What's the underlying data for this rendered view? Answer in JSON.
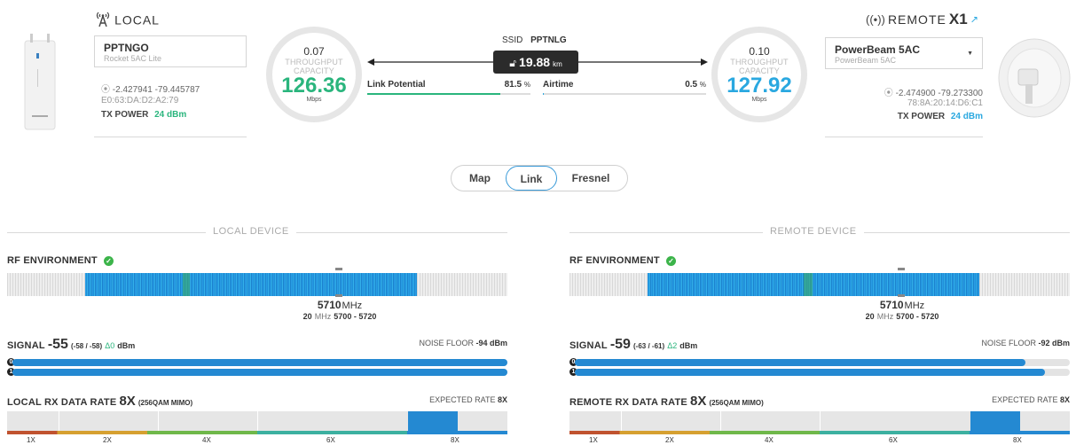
{
  "local": {
    "header": "LOCAL",
    "device_name": "PPTNGO",
    "device_model": "Rocket 5AC Lite",
    "coords": "-2.427941 -79.445787",
    "mac": "E0:63:DA:D2:A2:79",
    "tx_power_label": "TX POWER",
    "tx_power_value": "24 dBm",
    "throughput": "0.07",
    "throughput_label": "THROUGHPUT",
    "capacity_label": "CAPACITY",
    "capacity": "126.36",
    "unit": "Mbps"
  },
  "remote": {
    "header": "REMOTE",
    "count": "X1",
    "device_name": "PowerBeam 5AC",
    "device_model": "PowerBeam 5AC",
    "coords": "-2.474900 -79.273300",
    "mac": "78:8A:20:14:D6:C1",
    "tx_power_label": "TX POWER",
    "tx_power_value": "24 dBm",
    "throughput": "0.10",
    "throughput_label": "THROUGHPUT",
    "capacity_label": "CAPACITY",
    "capacity": "127.92",
    "unit": "Mbps"
  },
  "link": {
    "ssid_label": "SSID",
    "ssid": "PPTNLG",
    "distance": "19.88",
    "distance_unit": "km",
    "potential_label": "Link Potential",
    "potential_value": "81.5",
    "potential_pct": 81.5,
    "airtime_label": "Airtime",
    "airtime_value": "0.5",
    "airtime_pct": 0.5,
    "pct": "%"
  },
  "tabs": [
    "Map",
    "Link",
    "Fresnel"
  ],
  "active_tab": "Link",
  "local_section": {
    "title": "LOCAL DEVICE",
    "rf_label": "RF ENVIRONMENT",
    "freq": "5710",
    "freq_unit": "MHz",
    "width": "20",
    "width_unit": "MHz",
    "range": "5700 - 5720",
    "signal_label": "SIGNAL",
    "signal": "-55",
    "signal_chains": "(-58 / -58)",
    "signal_delta": "Δ0",
    "signal_unit": "dBm",
    "noise_label": "NOISE FLOOR",
    "noise": "-94 dBm",
    "chain0": "0",
    "chain1": "1",
    "chain0_level": 1.0,
    "chain1_level": 1.0,
    "rate_label": "LOCAL RX DATA RATE",
    "rate": "8X",
    "rate_detail": "(256QAM MIMO)",
    "expected_label": "EXPECTED RATE",
    "expected": "8X",
    "rate_ticks": [
      "1X",
      "2X",
      "4X",
      "6X",
      "8X"
    ]
  },
  "remote_section": {
    "title": "REMOTE DEVICE",
    "rf_label": "RF ENVIRONMENT",
    "freq": "5710",
    "freq_unit": "MHz",
    "width": "20",
    "width_unit": "MHz",
    "range": "5700 - 5720",
    "signal_label": "SIGNAL",
    "signal": "-59",
    "signal_chains": "(-63 / -61)",
    "signal_delta": "Δ2",
    "signal_unit": "dBm",
    "noise_label": "NOISE FLOOR",
    "noise": "-92 dBm",
    "chain0": "0",
    "chain1": "1",
    "chain0_level": 0.91,
    "chain1_level": 0.95,
    "rate_label": "REMOTE RX DATA RATE",
    "rate": "8X",
    "rate_detail": "(256QAM MIMO)",
    "expected_label": "EXPECTED RATE",
    "expected": "8X",
    "rate_ticks": [
      "1X",
      "2X",
      "4X",
      "6X",
      "8X"
    ]
  },
  "colors": {
    "green": "#2ab57d",
    "blue": "#2aa8e0",
    "bar_blue": "#2489d2"
  }
}
